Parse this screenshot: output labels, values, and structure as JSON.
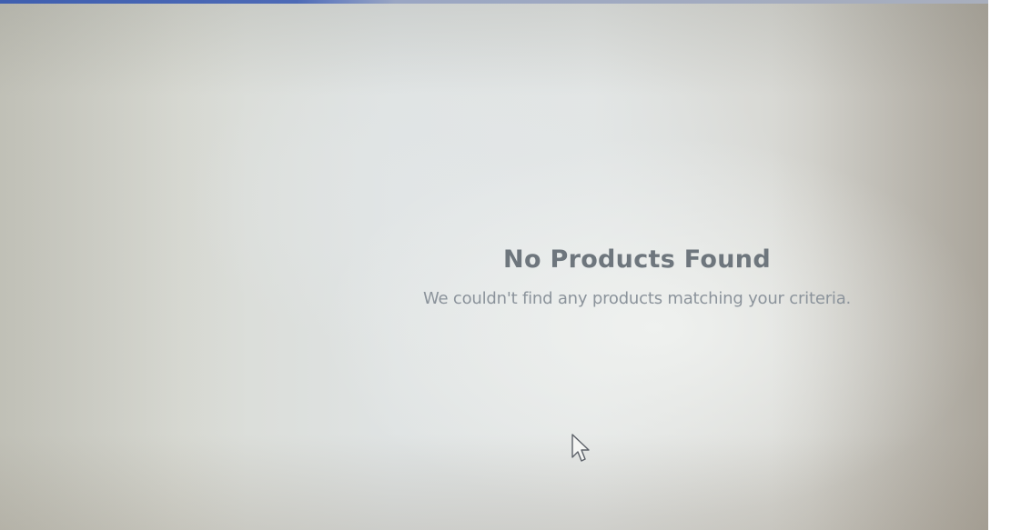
{
  "empty_state": {
    "title": "No Products Found",
    "message": "We couldn't find any products matching your criteria."
  },
  "icons": {
    "cursor": "mouse-pointer-icon"
  },
  "colors": {
    "top_bar_accent": "#3f5fb0",
    "title_text": "#6e767d",
    "message_text": "#8b939b"
  }
}
